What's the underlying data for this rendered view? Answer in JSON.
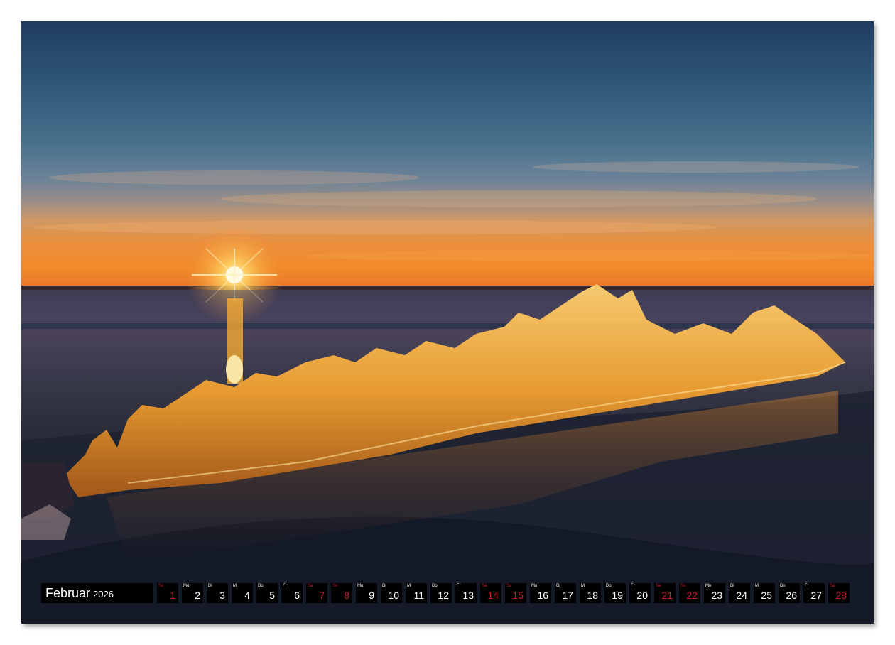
{
  "calendar": {
    "month": "Februar",
    "year": "2026",
    "days": [
      {
        "wd": "So",
        "d": "1",
        "we": true
      },
      {
        "wd": "Mo",
        "d": "2",
        "we": false
      },
      {
        "wd": "Di",
        "d": "3",
        "we": false
      },
      {
        "wd": "Mi",
        "d": "4",
        "we": false
      },
      {
        "wd": "Do",
        "d": "5",
        "we": false
      },
      {
        "wd": "Fr",
        "d": "6",
        "we": false
      },
      {
        "wd": "Sa",
        "d": "7",
        "we": true
      },
      {
        "wd": "So",
        "d": "8",
        "we": true
      },
      {
        "wd": "Mo",
        "d": "9",
        "we": false
      },
      {
        "wd": "Di",
        "d": "10",
        "we": false
      },
      {
        "wd": "Mi",
        "d": "11",
        "we": false
      },
      {
        "wd": "Do",
        "d": "12",
        "we": false
      },
      {
        "wd": "Fr",
        "d": "13",
        "we": false
      },
      {
        "wd": "Sa",
        "d": "14",
        "we": true
      },
      {
        "wd": "So",
        "d": "15",
        "we": true
      },
      {
        "wd": "Mo",
        "d": "16",
        "we": false
      },
      {
        "wd": "Di",
        "d": "17",
        "we": false
      },
      {
        "wd": "Mi",
        "d": "18",
        "we": false
      },
      {
        "wd": "Do",
        "d": "19",
        "we": false
      },
      {
        "wd": "Fr",
        "d": "20",
        "we": false
      },
      {
        "wd": "Sa",
        "d": "21",
        "we": true
      },
      {
        "wd": "So",
        "d": "22",
        "we": true
      },
      {
        "wd": "Mo",
        "d": "23",
        "we": false
      },
      {
        "wd": "Di",
        "d": "24",
        "we": false
      },
      {
        "wd": "Mi",
        "d": "25",
        "we": false
      },
      {
        "wd": "Do",
        "d": "26",
        "we": false
      },
      {
        "wd": "Fr",
        "d": "27",
        "we": false
      },
      {
        "wd": "Sa",
        "d": "28",
        "we": true
      }
    ]
  },
  "colors": {
    "weekend": "#c8202a",
    "weekday": "#ffffff",
    "bar": "#000000"
  }
}
